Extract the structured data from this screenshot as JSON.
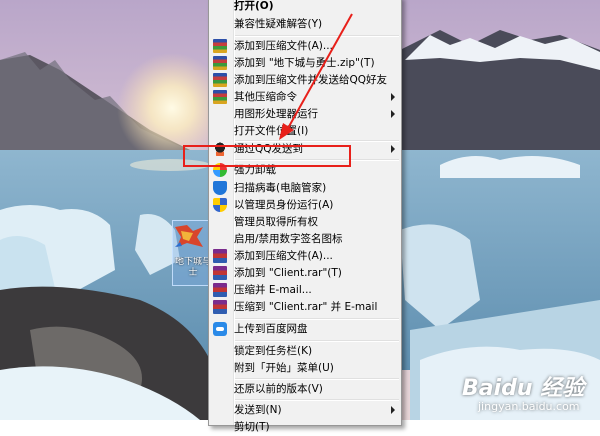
{
  "desktop": {
    "icon_label_line1": "地下城与",
    "icon_label_line2": "士"
  },
  "context_menu": {
    "items": [
      {
        "label": "打开(O)",
        "icon": "",
        "bold": true
      },
      {
        "label": "兼容性疑难解答(Y)",
        "icon": ""
      },
      {
        "label": "添加到压缩文件(A)...",
        "icon": "winrar-icon"
      },
      {
        "label": "添加到 \"地下城与勇士.zip\"(T)",
        "icon": "winrar-icon"
      },
      {
        "label": "添加到压缩文件并发送给QQ好友",
        "icon": "winrar-icon"
      },
      {
        "label": "其他压缩命令",
        "icon": "winrar-icon",
        "submenu": true
      },
      {
        "label": "用图形处理器运行",
        "icon": "",
        "submenu": true
      },
      {
        "label": "打开文件位置(I)",
        "icon": ""
      },
      {
        "label": "通过QQ发送到",
        "icon": "qq-icon",
        "submenu": true
      },
      {
        "label": "强力卸载",
        "icon": "uninstall-icon"
      },
      {
        "label": "扫描病毒(电脑管家)",
        "icon": "shield-icon"
      },
      {
        "label": "以管理员身份运行(A)",
        "icon": "uac-shield-icon"
      },
      {
        "label": "管理员取得所有权",
        "icon": ""
      },
      {
        "label": "启用/禁用数字签名图标",
        "icon": ""
      },
      {
        "label": "添加到压缩文件(A)...",
        "icon": "rar-books-icon"
      },
      {
        "label": "添加到 \"Client.rar\"(T)",
        "icon": "rar-books-icon"
      },
      {
        "label": "压缩并 E-mail...",
        "icon": "rar-books-icon"
      },
      {
        "label": "压缩到 \"Client.rar\" 并 E-mail",
        "icon": "rar-books-icon"
      },
      {
        "label": "上传到百度网盘",
        "icon": "baidu-cloud-icon"
      },
      {
        "label": "锁定到任务栏(K)",
        "icon": ""
      },
      {
        "label": "附到「开始」菜单(U)",
        "icon": ""
      },
      {
        "label": "还原以前的版本(V)",
        "icon": ""
      },
      {
        "label": "发送到(N)",
        "icon": "",
        "submenu": true
      },
      {
        "label": "剪切(T)",
        "icon": ""
      }
    ]
  },
  "annotation": {
    "highlight_color": "#e8201a"
  },
  "watermark": {
    "brand": "Baidu 经验",
    "url": "jingyan.baidu.com"
  }
}
